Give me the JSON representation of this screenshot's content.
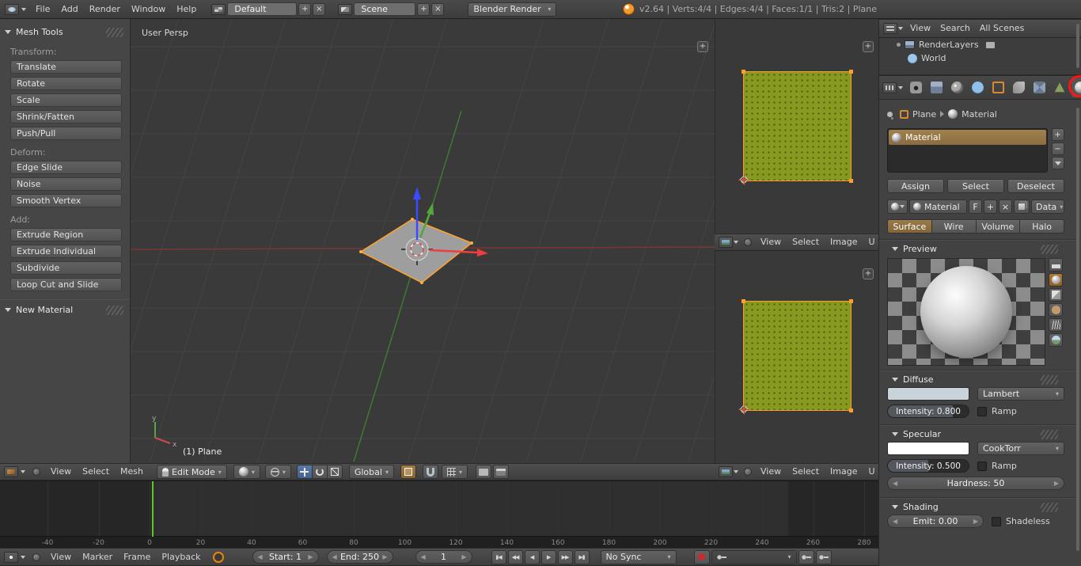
{
  "colors": {
    "accent_orange": "#e8860c",
    "selection_orange": "#ff9e2c",
    "frame_green": "#62c520",
    "record_red": "#cc2b2b",
    "annotation_red": "#ff1414"
  },
  "glyphs": {
    "plus": "+",
    "close": "×",
    "minus": "−",
    "dropdown": "▾",
    "left": "◀",
    "right": "▶"
  },
  "top_header": {
    "app_menus": [
      "File",
      "Add",
      "Render",
      "Window",
      "Help"
    ],
    "layout_value": "Default",
    "scene_value": "Scene",
    "engine_value": "Blender Render",
    "stats": "v2.64 | Verts:4/4 | Edges:4/4 | Faces:1/1 | Tris:2 | Plane"
  },
  "tool_shelf": {
    "panel_title": "Mesh Tools",
    "sections": [
      {
        "label": "Transform:",
        "buttons": [
          "Translate",
          "Rotate",
          "Scale",
          "Shrink/Fatten",
          "Push/Pull"
        ]
      },
      {
        "label": "Deform:",
        "buttons": [
          "Edge Slide",
          "Noise",
          "Smooth Vertex"
        ]
      },
      {
        "label": "Add:",
        "buttons": [
          "Extrude Region",
          "Extrude Individual",
          "Subdivide",
          "Loop Cut and Slide"
        ]
      }
    ],
    "second_panel_title": "New Material"
  },
  "viewport_3d": {
    "view_label": "User Persp",
    "object_info": "(1) Plane",
    "menus": [
      "View",
      "Select",
      "Mesh"
    ],
    "mode": "Edit Mode",
    "orientation": "Global",
    "axis_labels": {
      "x": "x",
      "y": "y"
    }
  },
  "uv_editor": {
    "menus": [
      "View",
      "Select",
      "Image"
    ],
    "menus_clipped": "U"
  },
  "outliner": {
    "menus": [
      "View",
      "Search",
      "All Scenes"
    ],
    "items": [
      "RenderLayers",
      "World"
    ]
  },
  "properties": {
    "tab_icons": [
      "render",
      "render-layers",
      "scene",
      "world",
      "object",
      "constraints",
      "modifiers",
      "object-data",
      "material",
      "texture",
      "particles"
    ],
    "active_tab": "material",
    "breadcrumb": {
      "object": "Plane",
      "material": "Material"
    },
    "material_slot": "Material",
    "slot_actions": [
      "Assign",
      "Select",
      "Deselect"
    ],
    "datablock": {
      "name": "Material",
      "fake_user": "F",
      "data": "Data"
    },
    "type_tabs": [
      "Surface",
      "Wire",
      "Volume",
      "Halo"
    ],
    "active_type": "Surface",
    "preview_panel": {
      "title": "Preview",
      "types": [
        "flat",
        "sphere",
        "cube",
        "monkey",
        "hair",
        "world"
      ],
      "active_type": "sphere"
    },
    "diffuse_panel": {
      "title": "Diffuse",
      "shader": "Lambert",
      "intensity": "Intensity: 0.800",
      "intensity_fill": 0.8,
      "ramp": "Ramp",
      "color": "#c9d3da"
    },
    "specular_panel": {
      "title": "Specular",
      "shader": "CookTorr",
      "intensity": "Intensity: 0.500",
      "intensity_fill": 0.5,
      "ramp": "Ramp",
      "hardness": "Hardness: 50",
      "color": "#ffffff"
    },
    "shading_panel": {
      "title": "Shading",
      "emit": "Emit: 0.00",
      "shadeless": "Shadeless"
    }
  },
  "timeline": {
    "ticks": [
      "-40",
      "-20",
      "0",
      "20",
      "40",
      "60",
      "80",
      "100",
      "120",
      "140",
      "160",
      "180",
      "200",
      "220",
      "240",
      "260",
      "280"
    ],
    "menus": [
      "View",
      "Marker",
      "Frame",
      "Playback"
    ],
    "start": "Start: 1",
    "end": "End: 250",
    "current_frame": "1",
    "sync": "No Sync",
    "playback_buttons": [
      {
        "name": "jump-to-start-button",
        "glyph": "▮◀"
      },
      {
        "name": "previous-keyframe-button",
        "glyph": "◀◀"
      },
      {
        "name": "play-reverse-button",
        "glyph": "◀"
      },
      {
        "name": "play-button",
        "glyph": "▶"
      },
      {
        "name": "next-keyframe-button",
        "glyph": "▶▶"
      },
      {
        "name": "jump-to-end-button",
        "glyph": "▶▮"
      }
    ]
  }
}
